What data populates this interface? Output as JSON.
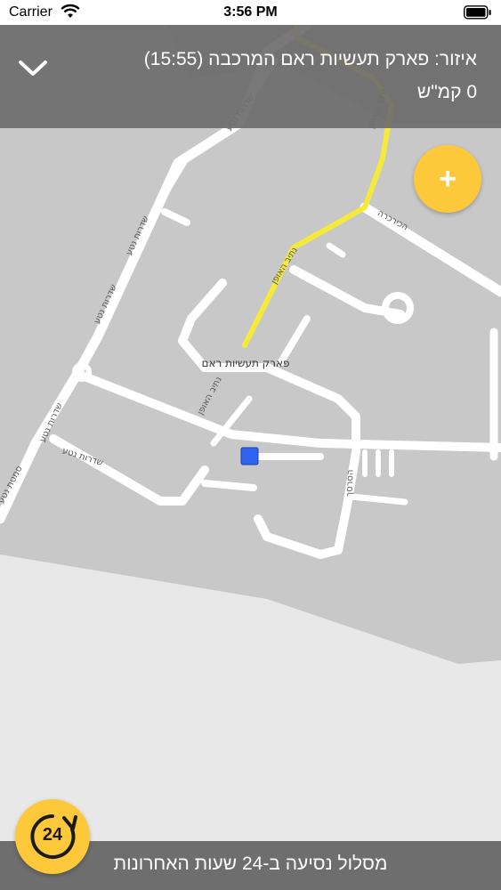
{
  "status_bar": {
    "carrier": "Carrier",
    "time": "3:56 PM"
  },
  "header": {
    "area_title": "איזור: פארק תעשיות ראם המרכבה (15:55)",
    "speed": "0 קמ\"ש",
    "collapse_icon": "chevron-down-icon"
  },
  "add_button": {
    "icon": "plus-icon"
  },
  "map": {
    "labels": {
      "park": "פארק תעשיות ראם",
      "street_netiv": "נתיב האופן",
      "street_sderot": "שדרות נטע",
      "street_hakirkara": "הכירכרה",
      "street_haseres": "הסרסך",
      "street_simta": "סמטת נטע"
    },
    "colors": {
      "route": "#f5ea3a",
      "position_marker": "#2f63f0",
      "road": "#ffffff",
      "zone": "#c8c8c8",
      "background": "#e8e8e8"
    }
  },
  "bottom": {
    "route_label": "מסלול נסיעה ב-24 שעות האחרונות",
    "history_button_text": "24",
    "history_icon": "rotate-clock-icon"
  }
}
